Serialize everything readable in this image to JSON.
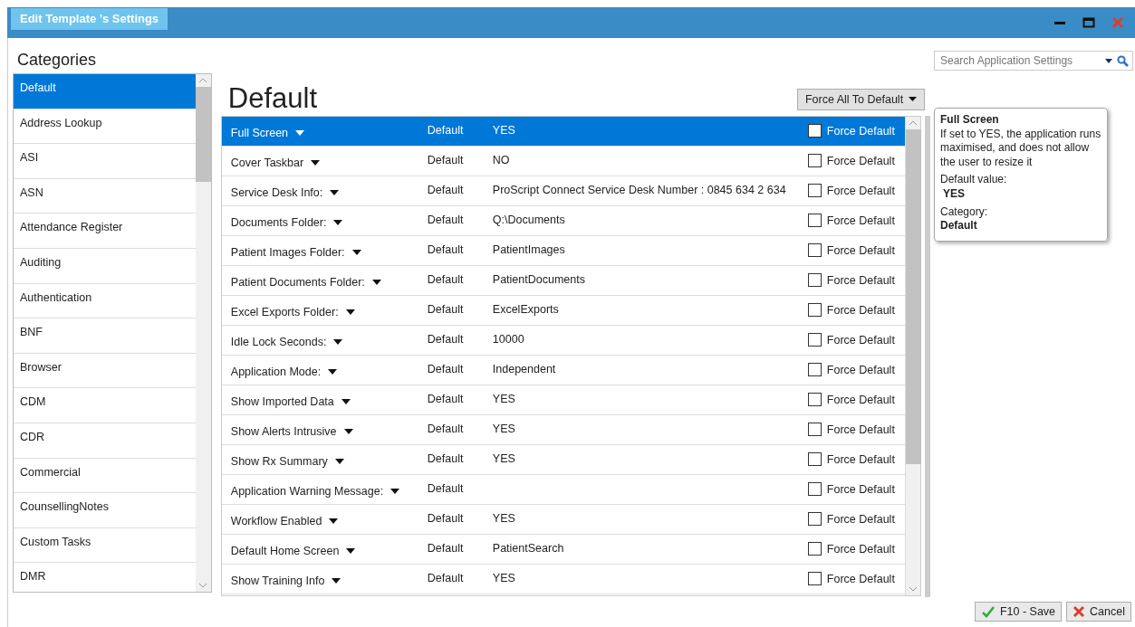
{
  "window": {
    "title": "Edit Template 's Settings"
  },
  "categories": {
    "heading": "Categories",
    "items": [
      {
        "label": "Default",
        "selected": true
      },
      {
        "label": "Address Lookup",
        "selected": false
      },
      {
        "label": "ASI",
        "selected": false
      },
      {
        "label": "ASN",
        "selected": false
      },
      {
        "label": "Attendance Register",
        "selected": false
      },
      {
        "label": "Auditing",
        "selected": false
      },
      {
        "label": "Authentication",
        "selected": false
      },
      {
        "label": "BNF",
        "selected": false
      },
      {
        "label": "Browser",
        "selected": false
      },
      {
        "label": "CDM",
        "selected": false
      },
      {
        "label": "CDR",
        "selected": false
      },
      {
        "label": "Commercial",
        "selected": false
      },
      {
        "label": "CounsellingNotes",
        "selected": false
      },
      {
        "label": "Custom Tasks",
        "selected": false
      },
      {
        "label": "DMR",
        "selected": false
      }
    ]
  },
  "search": {
    "placeholder": "Search Application Settings"
  },
  "page_title": "Default",
  "force_all_button": "Force All To Default",
  "settings": [
    {
      "name": "Full Screen",
      "source": "Default",
      "value": "YES",
      "force_label": "Force Default",
      "force_default": false,
      "selected": true
    },
    {
      "name": "Cover Taskbar",
      "source": "Default",
      "value": "NO",
      "force_label": "Force Default",
      "force_default": false,
      "selected": false
    },
    {
      "name": "Service Desk Info:",
      "source": "Default",
      "value": "ProScript Connect Service Desk Number : 0845 634 2 634",
      "force_label": "Force Default",
      "force_default": false,
      "selected": false
    },
    {
      "name": "Documents Folder:",
      "source": "Default",
      "value": "Q:\\Documents",
      "force_label": "Force Default",
      "force_default": false,
      "selected": false
    },
    {
      "name": "Patient Images Folder:",
      "source": "Default",
      "value": "PatientImages",
      "force_label": "Force Default",
      "force_default": false,
      "selected": false
    },
    {
      "name": "Patient Documents Folder:",
      "source": "Default",
      "value": "PatientDocuments",
      "force_label": "Force Default",
      "force_default": false,
      "selected": false
    },
    {
      "name": "Excel Exports Folder:",
      "source": "Default",
      "value": "ExcelExports",
      "force_label": "Force Default",
      "force_default": false,
      "selected": false
    },
    {
      "name": "Idle Lock Seconds:",
      "source": "Default",
      "value": "10000",
      "force_label": "Force Default",
      "force_default": false,
      "selected": false
    },
    {
      "name": "Application Mode:",
      "source": "Default",
      "value": "Independent",
      "force_label": "Force Default",
      "force_default": false,
      "selected": false
    },
    {
      "name": "Show Imported Data",
      "source": "Default",
      "value": "YES",
      "force_label": "Force Default",
      "force_default": false,
      "selected": false
    },
    {
      "name": "Show Alerts Intrusive",
      "source": "Default",
      "value": "YES",
      "force_label": "Force Default",
      "force_default": false,
      "selected": false
    },
    {
      "name": "Show Rx Summary",
      "source": "Default",
      "value": "YES",
      "force_label": "Force Default",
      "force_default": false,
      "selected": false
    },
    {
      "name": "Application Warning Message:",
      "source": "Default",
      "force_label": "Force Default",
      "force_default": false,
      "selected": false
    },
    {
      "name": "Workflow Enabled",
      "source": "Default",
      "value": "YES",
      "force_label": "Force Default",
      "force_default": false,
      "selected": false
    },
    {
      "name": "Default Home Screen",
      "source": "Default",
      "value": "PatientSearch",
      "force_label": "Force Default",
      "force_default": false,
      "selected": false
    },
    {
      "name": "Show Training Info",
      "source": "Default",
      "value": "YES",
      "force_label": "Force Default",
      "force_default": false,
      "selected": false
    }
  ],
  "tooltip": {
    "title": "Full Screen",
    "description": "If set to YES, the application runs maximised, and does not allow the user to resize it",
    "default_label": "Default value:",
    "default_value": "YES",
    "category_label": "Category:",
    "category_value": "Default"
  },
  "buttons": [
    {
      "label": "F10 - Save",
      "kind": "save"
    },
    {
      "label": "Cancel",
      "kind": "cancel"
    }
  ]
}
